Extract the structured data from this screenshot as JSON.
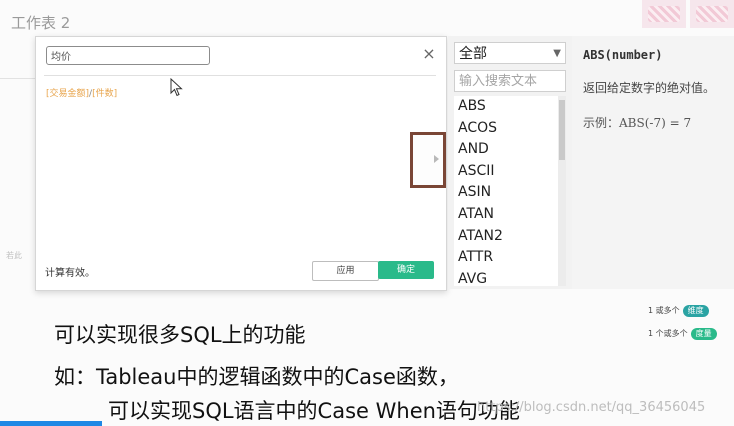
{
  "sheet": {
    "title": "工作表 2",
    "side_hint": "若此"
  },
  "dialog": {
    "name_value": "均价",
    "close_label": "×",
    "formula": {
      "field1": "[交易金额]",
      "operator": "/",
      "field2": "[件数]"
    },
    "status": "计算有效。",
    "apply_label": "应用",
    "ok_label": "确定"
  },
  "function_panel": {
    "category_selected": "全部",
    "search_placeholder": "输入搜索文本",
    "items": [
      "ABS",
      "ACOS",
      "AND",
      "ASCII",
      "ASIN",
      "ATAN",
      "ATAN2",
      "ATTR",
      "AVG"
    ]
  },
  "description": {
    "title": "ABS(number)",
    "text": "返回给定数字的绝对值。",
    "example": "示例：ABS(-7) = 7"
  },
  "right_pane": {
    "row1_text": "1 或多个",
    "row1_pill": "维度",
    "row2_text": "1 个或多个",
    "row2_pill": "度量"
  },
  "subtitles": {
    "line1": "可以实现很多SQL上的功能",
    "line2": "如：Tableau中的逻辑函数中的Case函数，",
    "line3": "可以实现SQL语言中的Case When语句功能"
  },
  "watermark": "https://blog.csdn.net/qq_36456045",
  "colors": {
    "accent": "#2aba8a",
    "field": "#e8a54d",
    "highlight_box": "#7a4636",
    "progress": "#1e88e5"
  }
}
